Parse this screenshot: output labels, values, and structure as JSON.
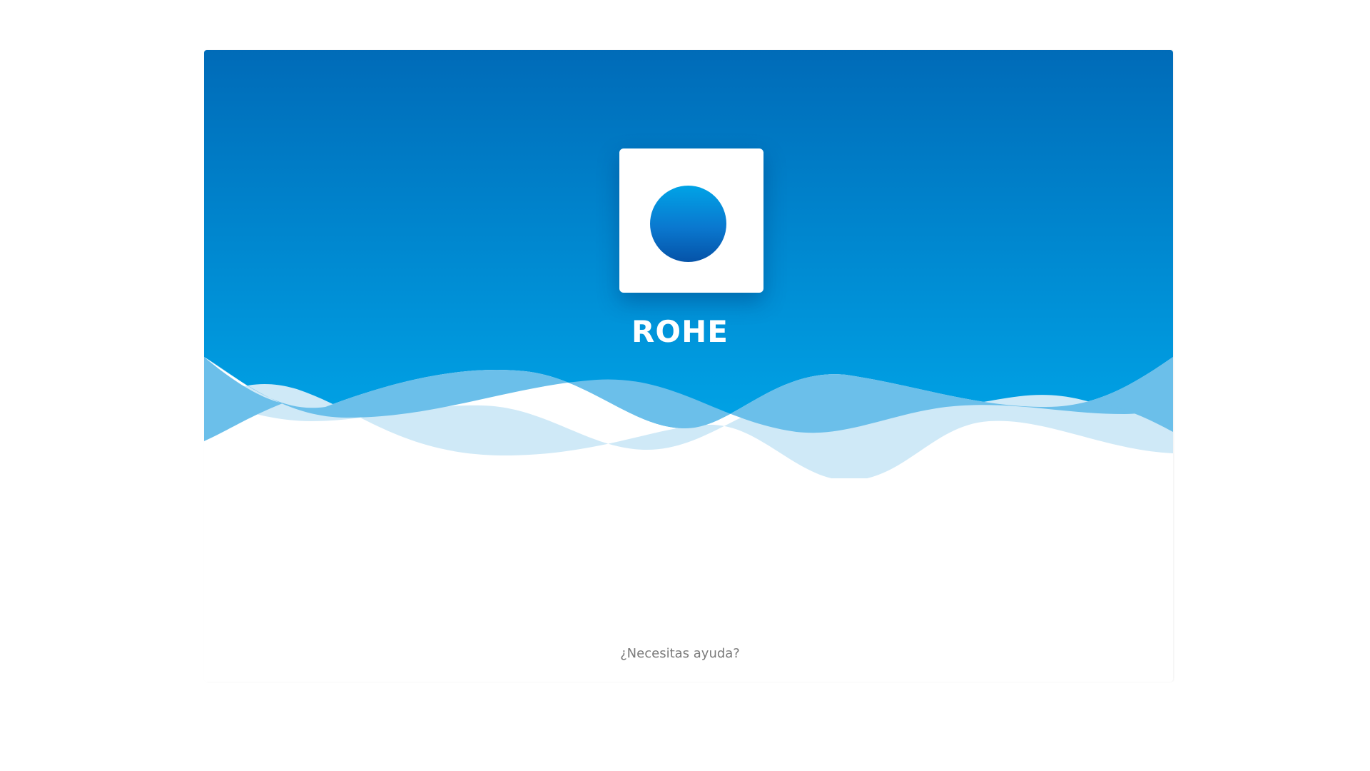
{
  "brand": {
    "name": "ROHE",
    "logo_icon": "circle-logo-icon"
  },
  "footer": {
    "help_label": "¿Necesitas ayuda?"
  },
  "colors": {
    "hero_top": "#006bb8",
    "hero_bottom": "#00a3e6",
    "wave_mid": "#6bbfea",
    "wave_light": "#cfe9f7",
    "help_text": "#7a7a7a"
  }
}
